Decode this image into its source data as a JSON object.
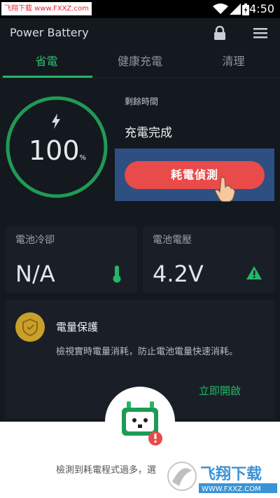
{
  "watermark": {
    "top_left_text": "飞翔下载 www.FXXZ.com",
    "brand_cn": "飞翔下载",
    "brand_url": "WWW.FXXZ.COM"
  },
  "status_bar": {
    "time": "4:50"
  },
  "app": {
    "title": "Power Battery"
  },
  "tabs": [
    {
      "label": "省電",
      "active": true
    },
    {
      "label": "健康充電",
      "active": false
    },
    {
      "label": "清理",
      "active": false
    }
  ],
  "battery": {
    "percent": "100",
    "percent_unit": "%",
    "level": 1.0
  },
  "remaining": {
    "label": "剩餘時間",
    "value": "充電完成"
  },
  "detect_button": {
    "label": "耗電偵測"
  },
  "stats": {
    "cooling": {
      "label": "電池冷卻",
      "value": "N/A"
    },
    "voltage": {
      "label": "電池電壓",
      "value": "4.2V"
    }
  },
  "protection": {
    "title": "電量保護",
    "description": "檢視實時電量消耗，防止電池電量快速消耗。",
    "action": "立即開啟"
  },
  "sheet": {
    "message": "檢測到耗電程式過多，選"
  },
  "colors": {
    "accent_green": "#22b866",
    "alert_red": "#e94a4a",
    "background": "#14181f",
    "card": "#1a1f27",
    "highlight_blue": "#2d4f82",
    "shield_gold": "#caa02a"
  }
}
